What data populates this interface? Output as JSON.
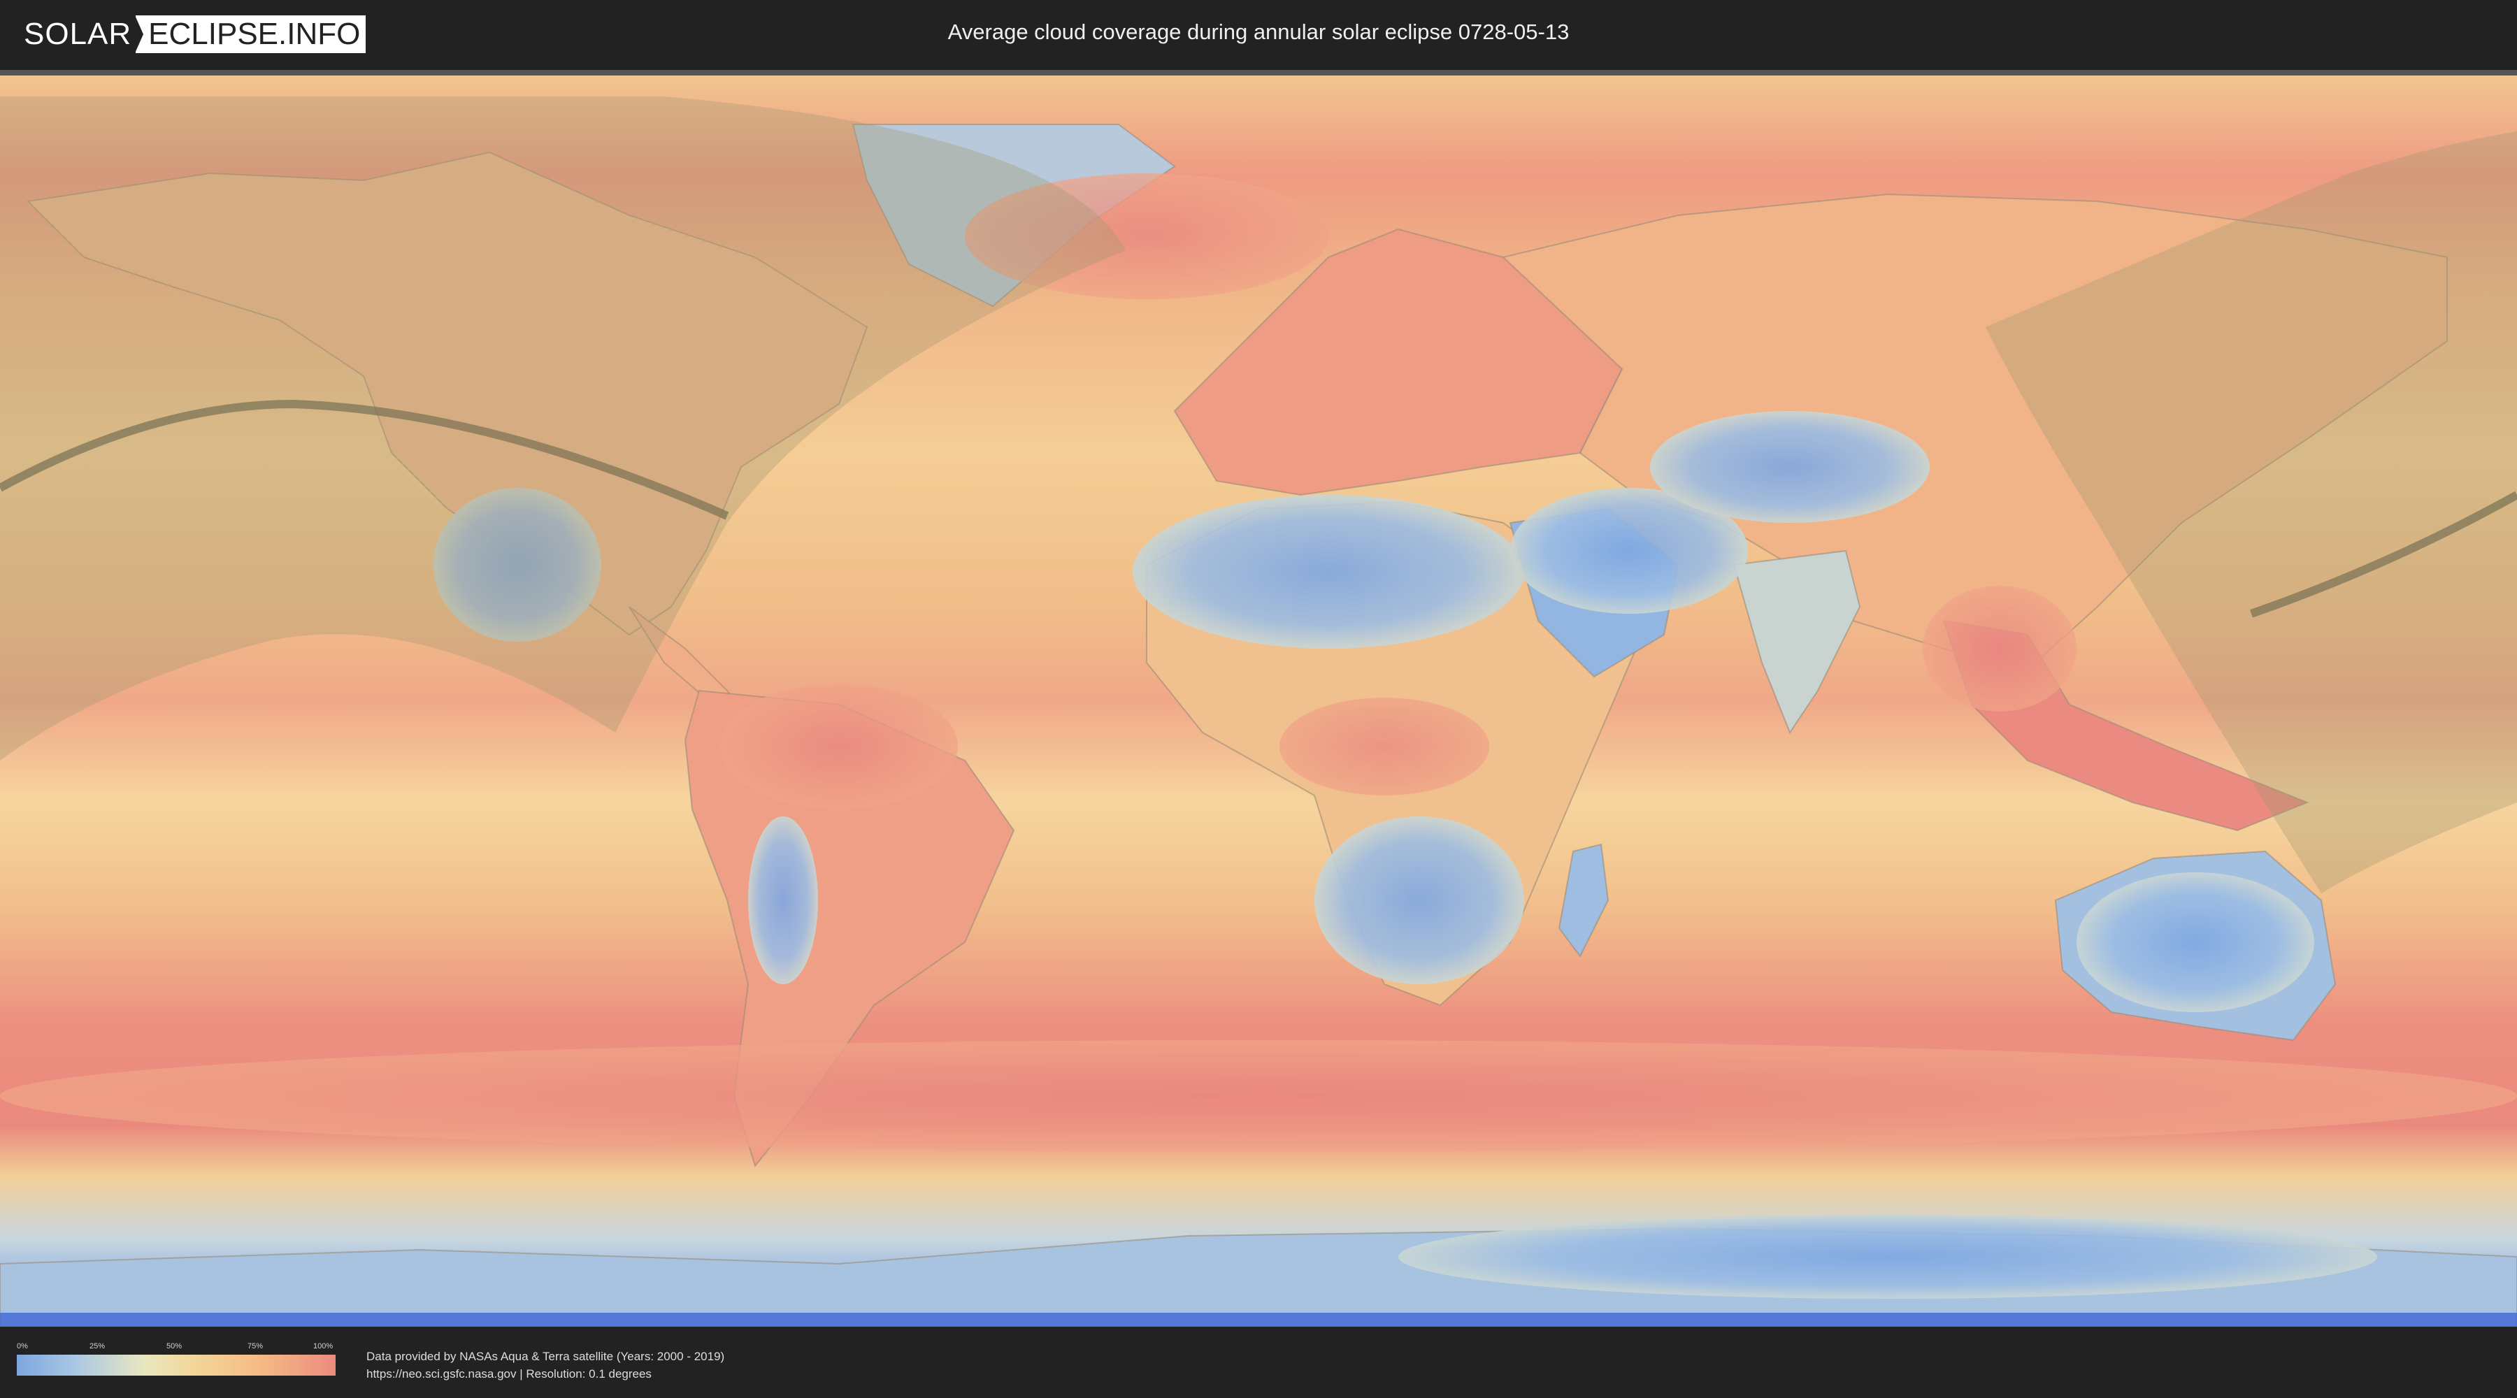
{
  "header": {
    "logo_left": "SOLAR",
    "logo_right": "ECLIPSE.INFO",
    "title": "Average cloud coverage during annular solar eclipse 0728-05-13"
  },
  "legend": {
    "ticks": [
      "0%",
      "25%",
      "50%",
      "75%",
      "100%"
    ],
    "colors": {
      "low": "#7ea6e0",
      "mid": "#f3d79b",
      "high": "#ec8b80"
    }
  },
  "footer": {
    "credit_line1": "Data provided by NASAs Aqua & Terra satellite (Years: 2000 - 2019)",
    "credit_line2": "https://neo.sci.gsfc.nasa.gov | Resolution: 0.1 degrees"
  },
  "map": {
    "projection": "equirectangular",
    "eclipse_path_color": "#7d7455",
    "visibility_overlay_color": "#a29770"
  }
}
